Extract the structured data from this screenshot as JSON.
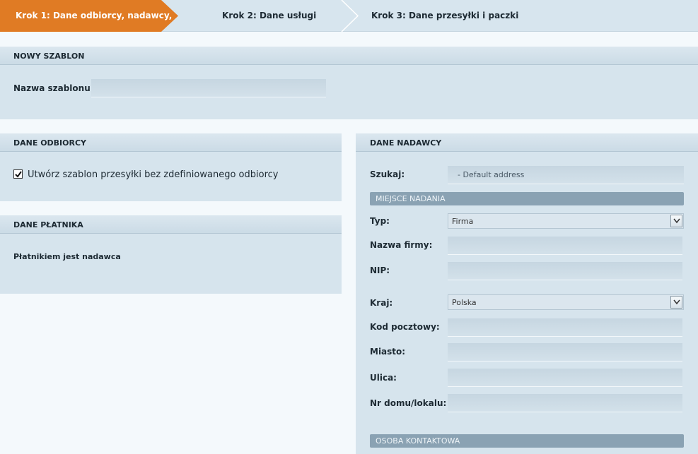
{
  "steps": {
    "step1": "Krok 1: Dane odbiorcy, nadawcy,",
    "step2": "Krok 2: Dane usługi",
    "step3": "Krok 3: Dane przesyłki i paczki"
  },
  "new_template": {
    "title": "NOWY SZABLON",
    "name_label": "Nazwa szablonu:",
    "name_value": ""
  },
  "recipient": {
    "title": "DANE ODBIORCY",
    "checkbox_label": "Utwórz szablon przesyłki bez zdefiniowanego odbiorcy",
    "checked": true
  },
  "payer": {
    "title": "DANE PŁATNIKA",
    "text": "Płatnikiem jest nadawca"
  },
  "sender": {
    "title": "DANE NADAWCY",
    "search_label": "Szukaj:",
    "search_value": "- Default address",
    "origin_title": "MIEJSCE NADANIA",
    "type_label": "Typ:",
    "type_value": "Firma",
    "company_label": "Nazwa firmy:",
    "company_value": "",
    "nip_label": "NIP:",
    "nip_value": "",
    "country_label": "Kraj:",
    "country_value": "Polska",
    "postal_label": "Kod pocztowy:",
    "postal_value": "",
    "city_label": "Miasto:",
    "city_value": "",
    "street_label": "Ulica:",
    "street_value": "",
    "house_label": "Nr domu/lokalu:",
    "house_value": "",
    "contact_title": "OSOBA KONTAKTOWA"
  },
  "colors": {
    "active_step": "#e07b24",
    "panel_bg": "#d6e4ed",
    "subhead_bg": "#8aa2b3"
  }
}
